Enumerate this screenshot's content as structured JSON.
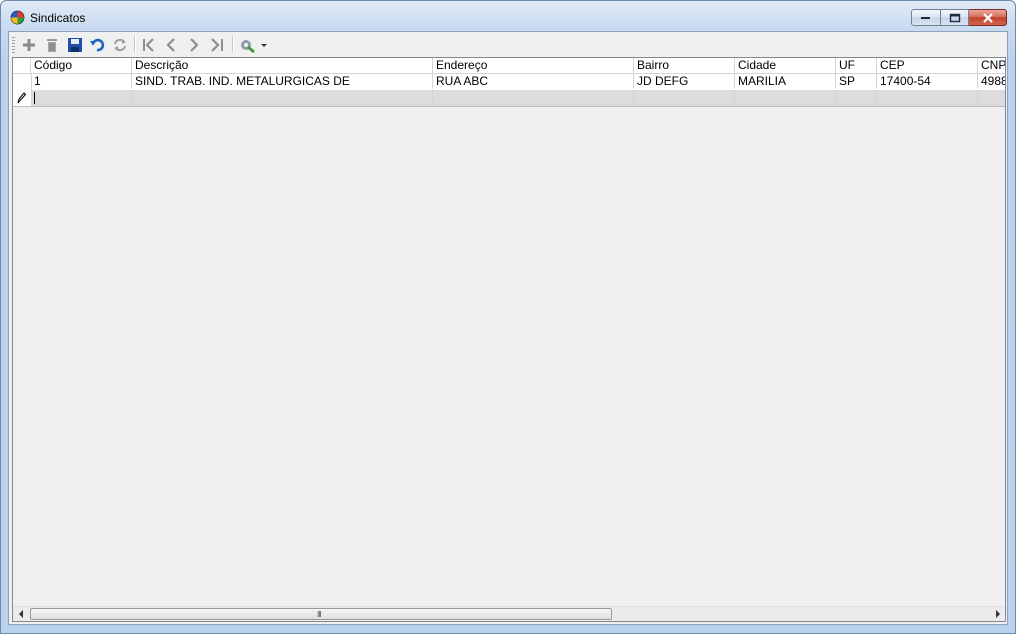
{
  "window": {
    "title": "Sindicatos"
  },
  "toolbar": {
    "buttons": [
      {
        "icon": "plus-icon"
      },
      {
        "icon": "trash-icon"
      },
      {
        "icon": "save-icon"
      },
      {
        "icon": "undo-icon"
      },
      {
        "icon": "refresh-icon"
      },
      {
        "icon": "first-record-icon"
      },
      {
        "icon": "previous-record-icon"
      },
      {
        "icon": "next-record-icon"
      },
      {
        "icon": "last-record-icon"
      },
      {
        "icon": "tools-dropdown-icon"
      }
    ]
  },
  "grid": {
    "columns": [
      "Código",
      "Descrição",
      "Endereço",
      "Bairro",
      "Cidade",
      "UF",
      "CEP",
      "CNPJ"
    ],
    "rows": [
      [
        "1",
        "SIND. TRAB. IND. METALURGICAS DE",
        "RUA ABC",
        "JD DEFG",
        "MARILIA",
        "SP",
        "17400-54",
        "4988"
      ]
    ],
    "scroll_grip": "III"
  },
  "colors": {
    "accent": "#1f5fbf",
    "title_bg": "#c7d9ef",
    "close": "#c0432b"
  }
}
